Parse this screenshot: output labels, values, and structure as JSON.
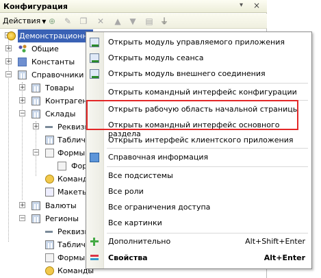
{
  "panel": {
    "title": "Конфигурация",
    "pin_icon": "pin-icon",
    "close_label": "×"
  },
  "toolbar": {
    "actions_label": "Действия",
    "icons": [
      "add-icon",
      "edit-icon",
      "copy-icon",
      "delete-icon",
      "move-up-icon",
      "move-down-icon",
      "list-icon",
      "filter-icon"
    ]
  },
  "tree": [
    {
      "label": "Демонстрационна",
      "icon": "configuration-root-icon",
      "selected": true
    },
    {
      "label": "Общие",
      "icon": "common-objects-icon"
    },
    {
      "label": "Константы",
      "icon": "constants-icon"
    },
    {
      "label": "Справочники",
      "icon": "catalogs-icon"
    },
    {
      "label": "Товары",
      "icon": "catalog-icon"
    },
    {
      "label": "Контрагенты",
      "icon": "catalog-icon"
    },
    {
      "label": "Склады",
      "icon": "catalog-icon"
    },
    {
      "label": "Реквизиты",
      "icon": "attributes-icon"
    },
    {
      "label": "Табличные",
      "icon": "tabular-sections-icon"
    },
    {
      "label": "Формы",
      "icon": "forms-icon"
    },
    {
      "label": "Форма",
      "icon": "form-icon"
    },
    {
      "label": "Команды",
      "icon": "commands-icon"
    },
    {
      "label": "Макеты",
      "icon": "templates-icon"
    },
    {
      "label": "Валюты",
      "icon": "catalog-icon"
    },
    {
      "label": "Регионы",
      "icon": "catalog-icon"
    },
    {
      "label": "Реквизиты",
      "icon": "attributes-icon"
    },
    {
      "label": "Табличные",
      "icon": "tabular-sections-icon"
    },
    {
      "label": "Формы",
      "icon": "forms-icon"
    },
    {
      "label": "Команды",
      "icon": "commands-icon"
    }
  ],
  "context_menu": {
    "items": [
      {
        "label": "Открыть модуль управляемого приложения",
        "icon": "module-icon"
      },
      {
        "label": "Открыть модуль сеанса",
        "icon": "module-icon"
      },
      {
        "label": "Открыть модуль внешнего соединения",
        "icon": "module-icon"
      },
      {
        "label": "Открыть командный интерфейс конфигурации"
      },
      {
        "label": "Открыть рабочую область начальной страницы"
      },
      {
        "label": "Открыть командный интерфейс основного раздела"
      },
      {
        "label": "Открыть интерфейс клиентского приложения"
      },
      {
        "label": "Справочная информация",
        "icon": "help-icon"
      },
      {
        "label": "Все подсистемы"
      },
      {
        "label": "Все роли"
      },
      {
        "label": "Все ограничения доступа"
      },
      {
        "label": "Все картинки"
      },
      {
        "label": "Дополнительно",
        "shortcut": "Alt+Shift+Enter",
        "icon": "more-icon"
      },
      {
        "label": "Свойства",
        "shortcut": "Alt+Enter",
        "icon": "properties-icon"
      }
    ]
  },
  "colors": {
    "selection": "#3a62b5",
    "highlight_border": "#e32626"
  }
}
